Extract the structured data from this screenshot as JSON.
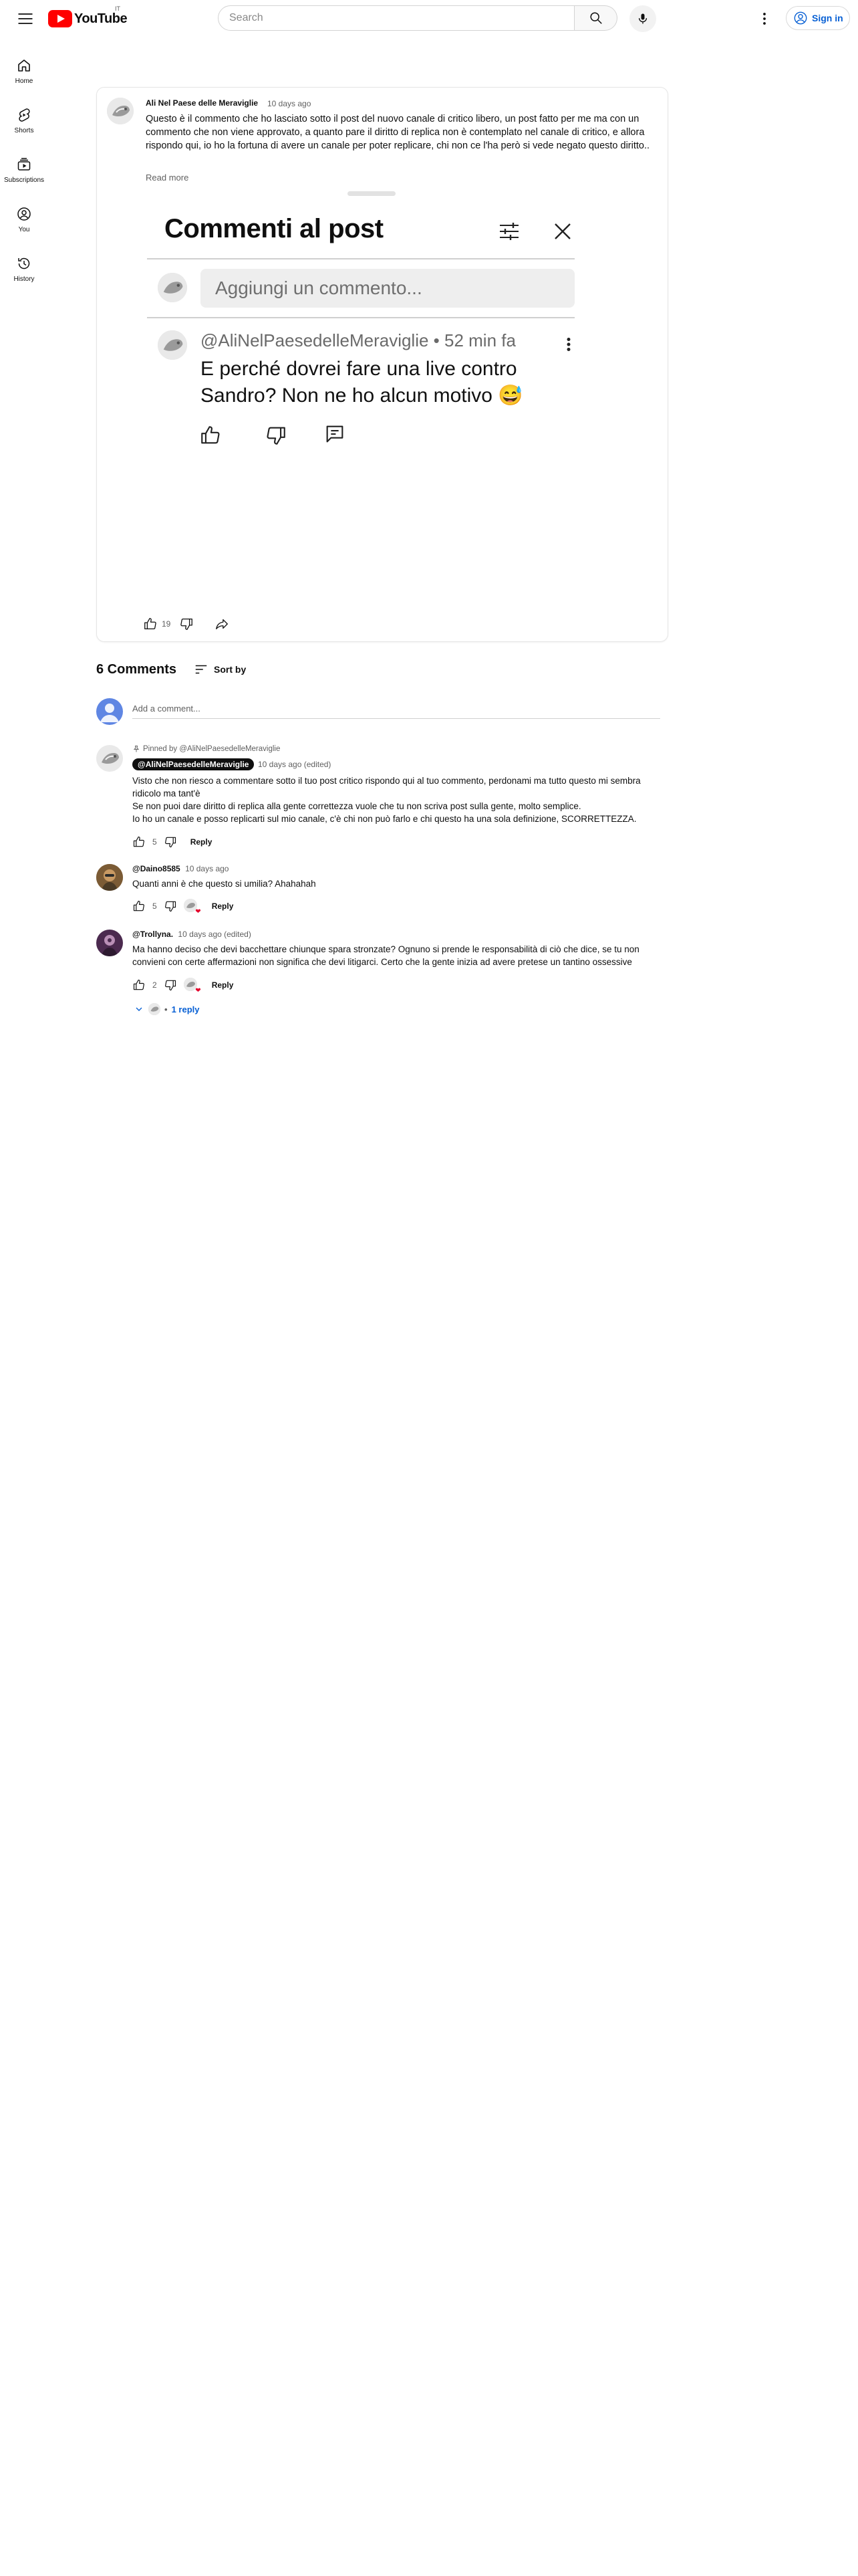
{
  "header": {
    "logo_text": "YouTube",
    "logo_country": "IT",
    "search_placeholder": "Search",
    "signin_label": "Sign in"
  },
  "sidebar": {
    "items": [
      {
        "label": "Home",
        "icon": "home-icon"
      },
      {
        "label": "Shorts",
        "icon": "shorts-icon"
      },
      {
        "label": "Subscriptions",
        "icon": "subscriptions-icon"
      },
      {
        "label": "You",
        "icon": "you-icon"
      },
      {
        "label": "History",
        "icon": "history-icon"
      }
    ]
  },
  "post": {
    "author": "Ali Nel Paese delle Meraviglie",
    "time": "10 days ago",
    "text": "Questo è il commento che ho lasciato sotto il post del nuovo canale di critico libero, un post fatto per me ma con un commento che non viene approvato, a quanto pare il diritto di replica non è contemplato nel canale di critico, e allora rispondo qui, io ho la fortuna di avere un canale per poter replicare, chi non ce l'ha però si vede negato questo diritto..",
    "read_more": "Read more",
    "like_count": "19",
    "image": {
      "title": "Commenti al post",
      "input_placeholder": "Aggiungi un commento...",
      "comment_author": "@AliNelPaesedelleMeraviglie • 52 min fa",
      "comment_text": "E perché dovrei fare una live contro Sandro? Non ne ho alcun motivo 😅"
    }
  },
  "comments_section": {
    "count_label": "6 Comments",
    "sort_label": "Sort by",
    "add_placeholder": "Add a comment..."
  },
  "comments": [
    {
      "pinned_label": "Pinned by @AliNelPaesedelleMeraviglie",
      "author": "@AliNelPaesedelleMeraviglie",
      "time": "10 days ago (edited)",
      "text": "Visto che non riesco a commentare sotto il tuo post critico rispondo qui al tuo commento, perdonami ma tutto questo mi sembra ridicolo ma tant'è\nSe non puoi dare diritto di replica alla gente correttezza vuole che tu non scriva post sulla gente, molto semplice.\nIo ho un canale e posso replicarti sul mio canale, c'è chi non può farlo e chi questo ha una sola definizione, SCORRETTEZZA.",
      "likes": "5",
      "reply_label": "Reply"
    },
    {
      "author": "@Daino8585",
      "time": "10 days ago",
      "text": "Quanti anni è che questo si umilia? Ahahahah",
      "likes": "5",
      "reply_label": "Reply"
    },
    {
      "author": "@Trollyna.",
      "time": "10 days ago (edited)",
      "text": "Ma hanno deciso che devi bacchettare chiunque spara stronzate? Ognuno si prende le responsabilità di ciò che dice, se tu non convieni con certe affermazioni non significa che devi litigarci. Certo che la gente inizia ad avere pretese un tantino ossessive",
      "likes": "2",
      "reply_label": "Reply",
      "replies_label": "1 reply"
    }
  ],
  "colors": {
    "accent_blue": "#065fd4",
    "logo_red": "#ff0000",
    "heart_red": "#e4002b"
  }
}
